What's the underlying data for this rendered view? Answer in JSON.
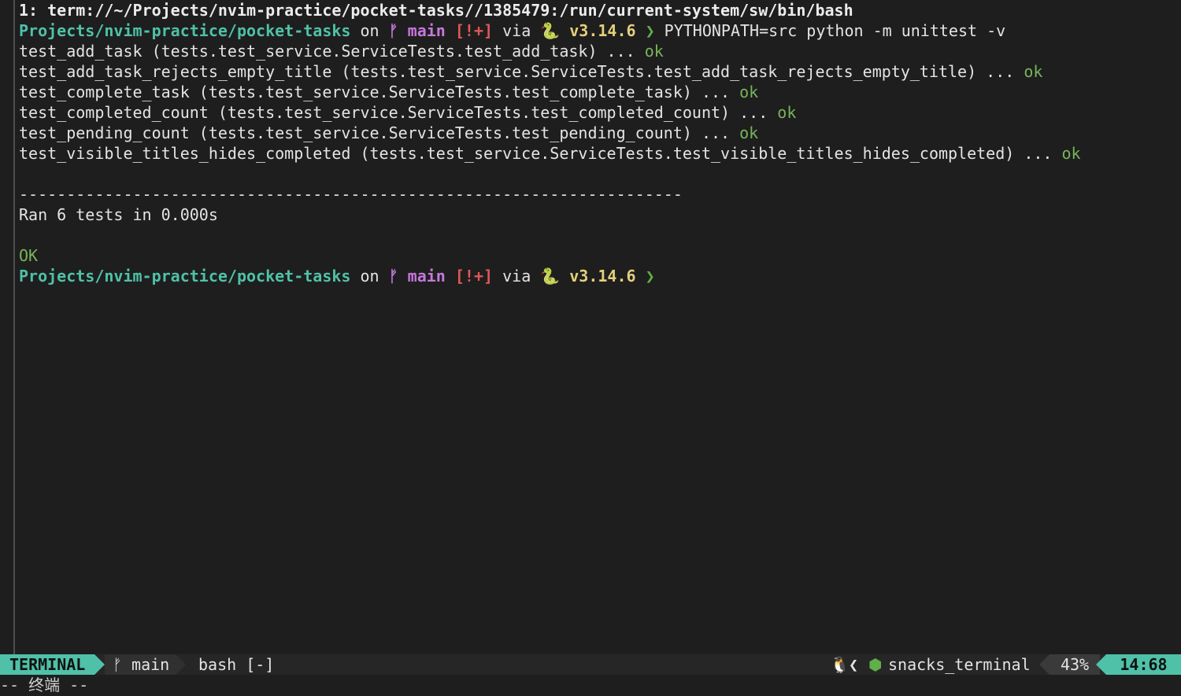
{
  "winbar": {
    "title": "1: term://~/Projects/nvim-practice/pocket-tasks//1385479:/run/current-system/sw/bin/bash"
  },
  "prompt": {
    "path": "Projects/nvim-practice/pocket-tasks",
    "on": "on",
    "git_icon": "git-branch-icon",
    "branch": "main",
    "status": "[!+]",
    "via": "via",
    "python_icon": "🐍",
    "python_version": "v3.14.6",
    "symbol": "❯"
  },
  "command": "PYTHONPATH=src python -m unittest -v",
  "tests": [
    {
      "line": "test_add_task (tests.test_service.ServiceTests.test_add_task) ... ",
      "result": "ok"
    },
    {
      "line": "test_add_task_rejects_empty_title (tests.test_service.ServiceTests.test_add_task_rejects_empty_title) ... ",
      "result": "ok"
    },
    {
      "line": "test_complete_task (tests.test_service.ServiceTests.test_complete_task) ... ",
      "result": "ok"
    },
    {
      "line": "test_completed_count (tests.test_service.ServiceTests.test_completed_count) ... ",
      "result": "ok"
    },
    {
      "line": "test_pending_count (tests.test_service.ServiceTests.test_pending_count) ... ",
      "result": "ok"
    },
    {
      "line": "test_visible_titles_hides_completed (tests.test_service.ServiceTests.test_visible_titles_hides_completed) ... ",
      "result": "ok"
    }
  ],
  "separator": "----------------------------------------------------------------------",
  "summary": "Ran 6 tests in 0.000s",
  "final_status": "OK",
  "statusline": {
    "mode": "TERMINAL",
    "branch_icon": "git-branch-icon",
    "branch": "main",
    "filename": "bash [-]",
    "os_icon": "linux-tux-icon",
    "filetype_icon": "package-icon",
    "filetype": "snacks_terminal",
    "percent": "43%",
    "position": "14:68"
  },
  "cmdline": "-- 终端 --",
  "colors": {
    "accent": "#4fc1a8",
    "branch": "#c678dd",
    "status": "#e05757",
    "python": "#e5d07a",
    "ok": "#78b45a"
  }
}
